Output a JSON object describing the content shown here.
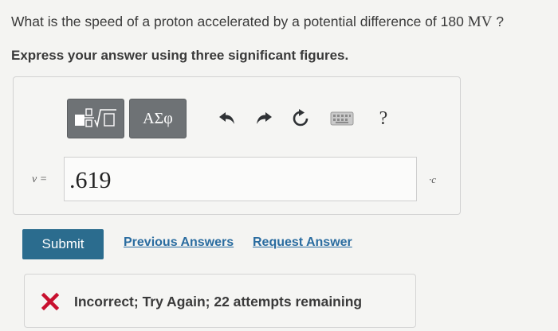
{
  "question": {
    "text_before": "What is the speed of a proton accelerated by a potential difference of 180 ",
    "unit": "MV",
    "text_after": " ?"
  },
  "instruction": "Express your answer using three significant figures.",
  "toolbar": {
    "templates_icon": "fraction-sqrt-icon",
    "symbols_label": "ΑΣφ",
    "undo_icon": "undo-icon",
    "redo_icon": "redo-icon",
    "reset_icon": "reset-icon",
    "keyboard_icon": "keyboard-icon",
    "help_label": "?"
  },
  "answer": {
    "variable_label": "v =",
    "value": ".619",
    "unit_label": "·c"
  },
  "actions": {
    "submit_label": "Submit",
    "previous_answers_label": "Previous Answers",
    "request_answer_label": "Request Answer"
  },
  "feedback": {
    "icon": "x-icon",
    "message": "Incorrect; Try Again; 22 attempts remaining"
  },
  "colors": {
    "submit_bg": "#2b6c8e",
    "link": "#2a6ca0",
    "error": "#c8102e",
    "tool_button_bg": "#6e7275"
  }
}
